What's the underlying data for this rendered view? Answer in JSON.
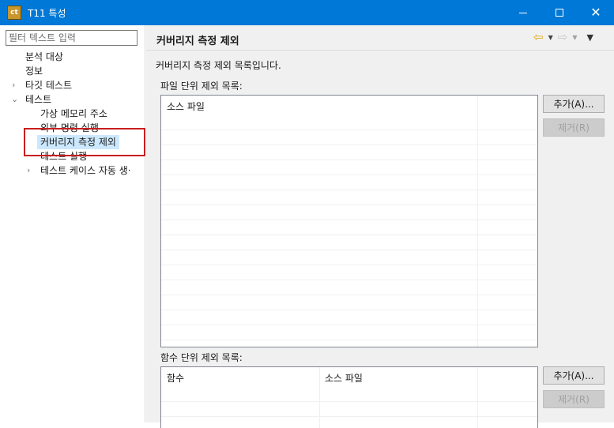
{
  "window": {
    "icon_text": "ct",
    "title": "T11 특성"
  },
  "sidebar": {
    "filter_placeholder": "필터 텍스트 입력",
    "items": [
      {
        "label": "분석 대상"
      },
      {
        "label": "정보"
      },
      {
        "label": "타깃 테스트",
        "twisty": "›"
      },
      {
        "label": "테스트",
        "twisty": "⌄"
      },
      {
        "label": "가상 메모리 주소"
      },
      {
        "label": "외부 명령 실행"
      },
      {
        "label": "커버리지 측정 제외"
      },
      {
        "label": "테스트 실행"
      },
      {
        "label": "테스트 케이스 자동 생·",
        "twisty": "›"
      }
    ]
  },
  "page": {
    "title": "커버리지 측정 제외",
    "description": "커버리지 측정 제외 목록입니다.",
    "file_section": {
      "label": "파일 단위 제외 목록:",
      "columns": [
        "소스 파일"
      ],
      "add_button": "추가(A)...",
      "remove_button": "제거(R)"
    },
    "function_section": {
      "label": "함수 단위 제외 목록:",
      "columns": [
        "함수",
        "소스 파일"
      ],
      "add_button": "추가(A)...",
      "remove_button": "제거(R)"
    }
  },
  "colors": {
    "titlebar": "#0078d7",
    "selection": "#cce8ff",
    "highlight_box": "#c81e1e"
  }
}
